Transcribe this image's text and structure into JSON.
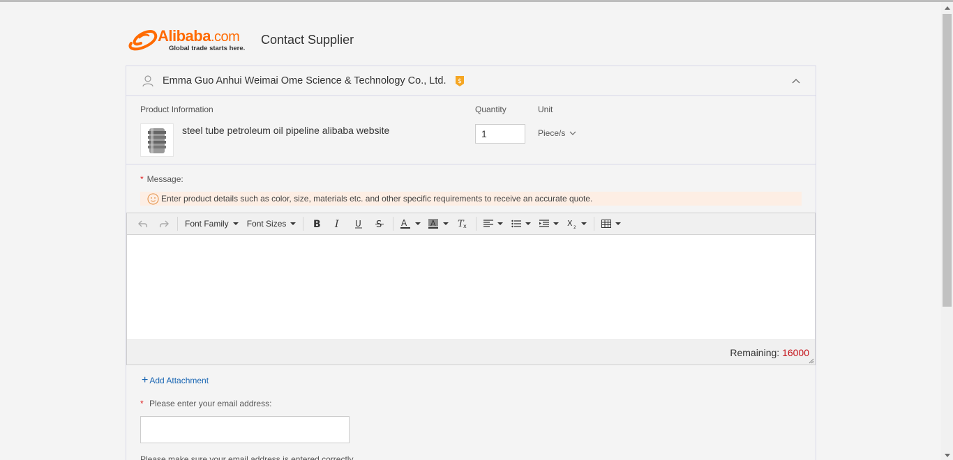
{
  "header": {
    "logo_word": "Alibaba",
    "logo_suffix": ".com",
    "logo_tagline": "Global trade starts here.",
    "title": "Contact Supplier"
  },
  "supplier": {
    "name": "Emma Guo Anhui Weimai Ome Science & Technology Co., Ltd.",
    "badge_color": "#f5a623"
  },
  "product": {
    "info_label": "Product Information",
    "quantity_label": "Quantity",
    "unit_label": "Unit",
    "name": "steel tube petroleum oil pipeline alibaba website",
    "quantity": "1",
    "unit": "Piece/s"
  },
  "message": {
    "required_mark": "*",
    "label": "Message:",
    "tip": "Enter product details such as color, size, materials etc. and other specific requirements to receive an accurate quote."
  },
  "editor": {
    "font_family": "Font Family",
    "font_sizes": "Font Sizes",
    "remaining_label": "Remaining:",
    "remaining_count": "16000",
    "remaining_color": "#c4121a"
  },
  "attachment": {
    "label": "Add Attachment"
  },
  "email": {
    "required_mark": "*",
    "label": "Please enter your email address:",
    "value": "",
    "note": "Please make sure your email address is entered correctly."
  },
  "colors": {
    "brand": "#ff6a00",
    "link": "#1a66b3",
    "tip_bg": "#fdeee4"
  }
}
